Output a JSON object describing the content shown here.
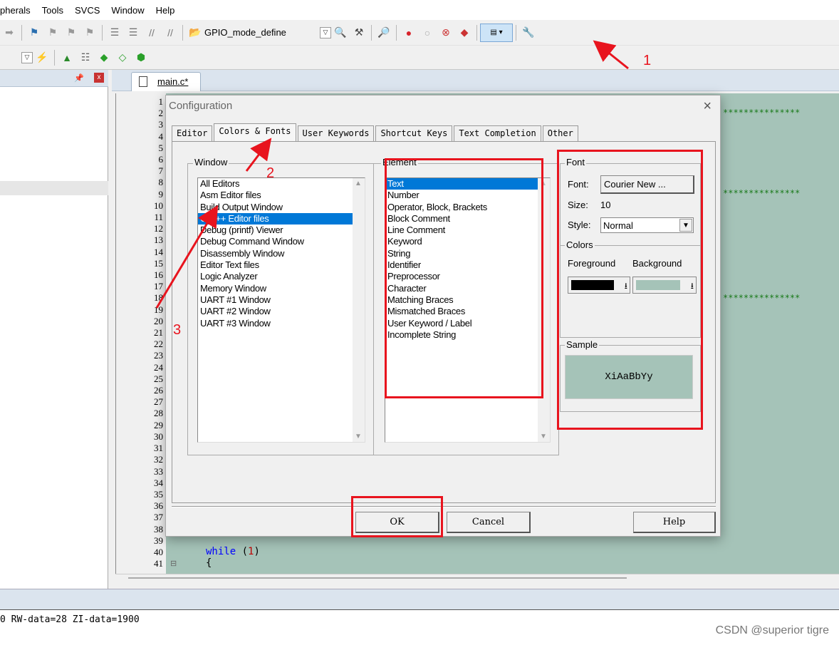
{
  "menu": [
    "pherals",
    "Tools",
    "SVCS",
    "Window",
    "Help"
  ],
  "toolbar": {
    "target_combo": "GPIO_mode_define"
  },
  "editor": {
    "tab": "main.c*",
    "line_numbers": [
      "1",
      "2",
      "3",
      "4",
      "5",
      "6",
      "7",
      "8",
      "9",
      "10",
      "11",
      "12",
      "13",
      "14",
      "15",
      "16",
      "17",
      "18",
      "19",
      "20",
      "21",
      "22",
      "23",
      "24",
      "25",
      "26",
      "27",
      "28",
      "29",
      "30",
      "31",
      "32",
      "33",
      "34",
      "35",
      "36",
      "37",
      "38",
      "39",
      "40",
      "41"
    ],
    "comment_stars": "***************",
    "code_while": "while",
    "code_paren_open": "(",
    "code_num": "1",
    "code_paren_close": ")",
    "code_brace": "{"
  },
  "build_output": {
    "line1": "0 RW-data=28 ZI-data=1900"
  },
  "watermark": "CSDN @superior tigre",
  "dialog": {
    "title": "Configuration",
    "close": "×",
    "tabs": [
      "Editor",
      "Colors & Fonts",
      "User Keywords",
      "Shortcut Keys",
      "Text Completion",
      "Other"
    ],
    "window_group": "Window",
    "window_items": [
      "All Editors",
      "Asm Editor files",
      "Build Output Window",
      "C/C++ Editor files",
      "Debug (printf) Viewer",
      "Debug Command Window",
      "Disassembly Window",
      "Editor Text files",
      "Logic Analyzer",
      "Memory Window",
      "UART #1 Window",
      "UART #2 Window",
      "UART #3 Window"
    ],
    "window_selected_index": 3,
    "element_group": "Element",
    "element_items": [
      "Text",
      "Number",
      "Operator, Block, Brackets",
      "Block Comment",
      "Line Comment",
      "Keyword",
      "String",
      "Identifier",
      "Preprocessor",
      "Character",
      "Matching Braces",
      "Mismatched Braces",
      "User Keyword / Label",
      "Incomplete String"
    ],
    "element_selected_index": 0,
    "font_group": "Font",
    "font_label": "Font:",
    "font_button": "Courier New ...",
    "size_label": "Size:",
    "size_value": "10",
    "style_label": "Style:",
    "style_value": "Normal",
    "colors_group": "Colors",
    "foreground_label": "Foreground",
    "background_label": "Background",
    "foreground_color": "#000000",
    "background_color": "#a5c3b8",
    "sample_group": "Sample",
    "sample_text": "XiAaBbYy",
    "ok": "OK",
    "cancel": "Cancel",
    "help": "Help"
  },
  "annotations": {
    "a1": "1",
    "a2": "2",
    "a3": "3"
  },
  "colors": {
    "annotation_red": "#e8141e",
    "editor_bg": "#a5c3b8",
    "selection": "#0078d7"
  }
}
